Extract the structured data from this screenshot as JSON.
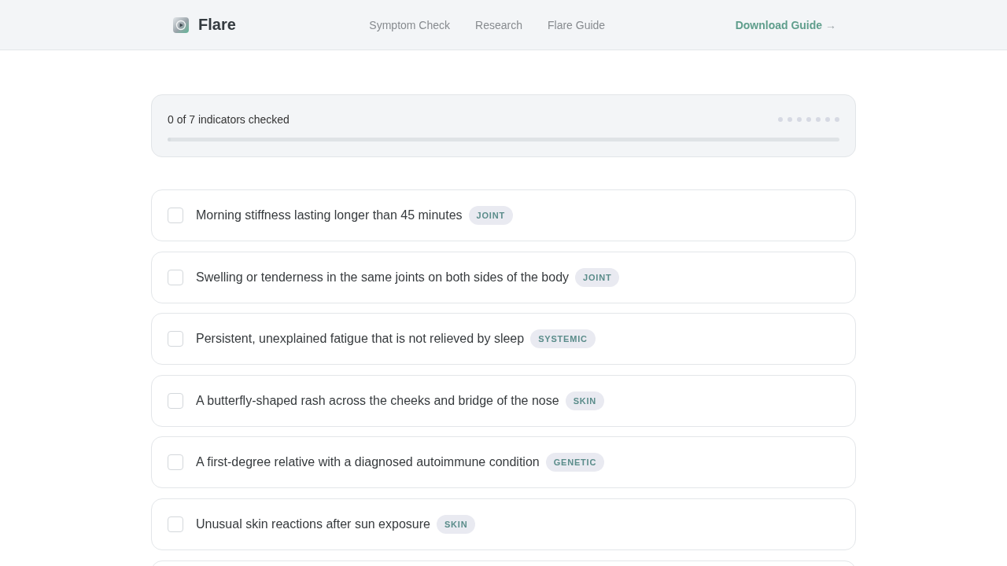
{
  "header": {
    "brand": "Flare",
    "nav": [
      {
        "label": "Symptom Check"
      },
      {
        "label": "Research"
      },
      {
        "label": "Flare Guide"
      }
    ],
    "cta": {
      "label": "Download Guide",
      "arrow": "→"
    }
  },
  "progress": {
    "label": "0 of 7 indicators checked",
    "level": 0,
    "dots": [
      {
        "filled": false
      },
      {
        "filled": false
      },
      {
        "filled": false
      },
      {
        "filled": false
      },
      {
        "filled": false
      },
      {
        "filled": false
      },
      {
        "filled": false
      }
    ]
  },
  "items": [
    {
      "text": "Morning stiffness lasting longer than 45 minutes",
      "tag": "JOINT",
      "checked": false
    },
    {
      "text": "Swelling or tenderness in the same joints on both sides of the body",
      "tag": "JOINT",
      "checked": false
    },
    {
      "text": "Persistent, unexplained fatigue that is not relieved by sleep",
      "tag": "SYSTEMIC",
      "checked": false
    },
    {
      "text": "A butterfly-shaped rash across the cheeks and bridge of the nose",
      "tag": "SKIN",
      "checked": false
    },
    {
      "text": "A first-degree relative with a diagnosed autoimmune condition",
      "tag": "GENETIC",
      "checked": false
    },
    {
      "text": "Unusual skin reactions after sun exposure",
      "tag": "SKIN",
      "checked": false
    }
  ]
}
